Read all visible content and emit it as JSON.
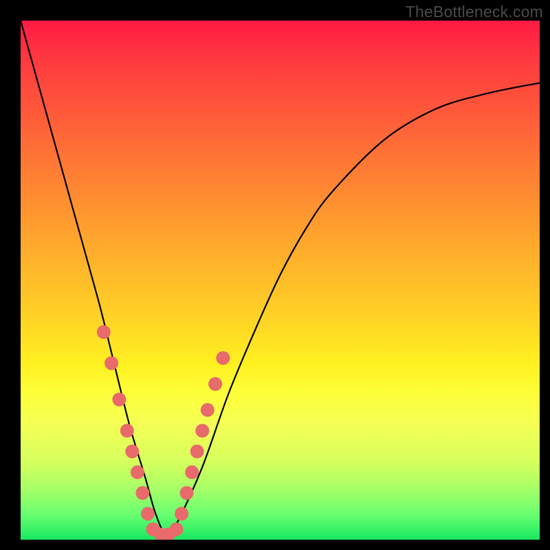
{
  "watermark": "TheBottleneck.com",
  "chart_data": {
    "type": "line",
    "title": "",
    "xlabel": "",
    "ylabel": "",
    "xlim": [
      0,
      100
    ],
    "ylim": [
      0,
      100
    ],
    "series": [
      {
        "name": "bottleneck-curve",
        "x": [
          0,
          5,
          10,
          15,
          18,
          21,
          24,
          26,
          28,
          30,
          35,
          40,
          45,
          50,
          55,
          60,
          70,
          80,
          90,
          100
        ],
        "values": [
          100,
          82,
          64,
          46,
          34,
          22,
          12,
          5,
          1,
          3,
          14,
          28,
          40,
          51,
          60,
          67,
          77,
          83,
          86,
          88
        ]
      }
    ],
    "markers": {
      "name": "highlight-dots",
      "color": "#e86a6a",
      "points": [
        {
          "x": 16.0,
          "y": 40
        },
        {
          "x": 17.5,
          "y": 34
        },
        {
          "x": 19.0,
          "y": 27
        },
        {
          "x": 20.5,
          "y": 21
        },
        {
          "x": 21.5,
          "y": 17
        },
        {
          "x": 22.5,
          "y": 13
        },
        {
          "x": 23.5,
          "y": 9
        },
        {
          "x": 24.5,
          "y": 5
        },
        {
          "x": 25.5,
          "y": 2
        },
        {
          "x": 27.0,
          "y": 1
        },
        {
          "x": 28.5,
          "y": 1
        },
        {
          "x": 30.0,
          "y": 2
        },
        {
          "x": 31.0,
          "y": 5
        },
        {
          "x": 32.0,
          "y": 9
        },
        {
          "x": 33.0,
          "y": 13
        },
        {
          "x": 34.0,
          "y": 17
        },
        {
          "x": 35.0,
          "y": 21
        },
        {
          "x": 36.0,
          "y": 25
        },
        {
          "x": 37.5,
          "y": 30
        },
        {
          "x": 39.0,
          "y": 35
        }
      ]
    }
  }
}
